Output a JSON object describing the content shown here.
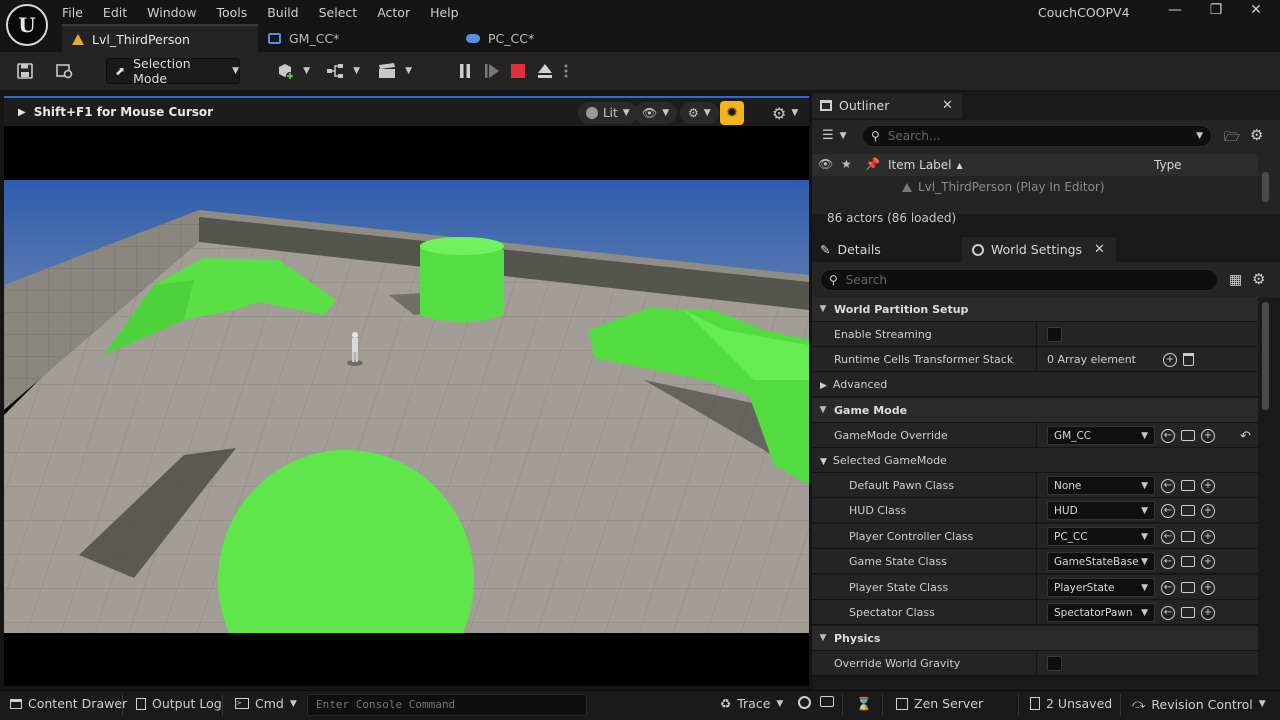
{
  "app": {
    "logo_text": "U",
    "title": "CouchCOOPV4",
    "menu": [
      "File",
      "Edit",
      "Window",
      "Tools",
      "Build",
      "Select",
      "Actor",
      "Help"
    ],
    "tabs": [
      "Lvl_ThirdPerson",
      "GM_CC*",
      "PC_CC*"
    ]
  },
  "toolbar": {
    "selection_mode": "Selection Mode"
  },
  "viewport": {
    "hint": "Shift+F1 for Mouse Cursor",
    "lit_label": "Lit"
  },
  "outliner": {
    "tab": "Outliner",
    "search_placeholder": "Search...",
    "col_item_label": "Item Label",
    "col_type": "Type",
    "row_level": "Lvl_ThirdPerson (Play In Editor)",
    "count": "86 actors (86 loaded)"
  },
  "details": {
    "tab_details": "Details",
    "tab_world_settings": "World Settings",
    "search_placeholder": "Search",
    "world_partition": {
      "header": "World Partition Setup",
      "enable_streaming": "Enable Streaming",
      "runtime_cells": "Runtime Cells Transformer Stack",
      "runtime_cells_value": "0 Array element",
      "advanced": "Advanced"
    },
    "game_mode": {
      "header": "Game Mode",
      "override_label": "GameMode Override",
      "override_value": "GM_CC",
      "selected_header": "Selected GameMode",
      "rows": [
        {
          "label": "Default Pawn Class",
          "value": "None"
        },
        {
          "label": "HUD Class",
          "value": "HUD"
        },
        {
          "label": "Player Controller Class",
          "value": "PC_CC"
        },
        {
          "label": "Game State Class",
          "value": "GameStateBase"
        },
        {
          "label": "Player State Class",
          "value": "PlayerState"
        },
        {
          "label": "Spectator Class",
          "value": "SpectatorPawn"
        }
      ]
    },
    "physics": {
      "header": "Physics",
      "override_gravity": "Override World Gravity"
    }
  },
  "statusbar": {
    "content_drawer": "Content Drawer",
    "output_log": "Output Log",
    "cmd": "Cmd",
    "console_placeholder": "Enter Console Command",
    "trace": "Trace",
    "zen_server": "Zen Server",
    "unsaved": "2 Unsaved",
    "revision_control": "Revision Control"
  },
  "colors": {
    "accent_blue": "#2f6ad8",
    "play_stop_red": "#e0303a",
    "level_orange": "#e3a93a",
    "realtime_yellow": "#f3b51c",
    "green_mesh": "#5ee64a"
  }
}
